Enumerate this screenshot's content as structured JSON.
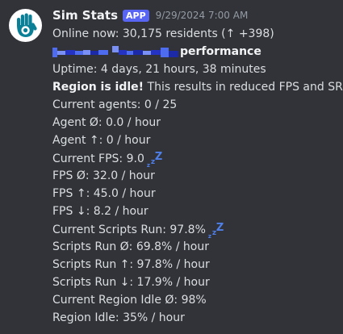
{
  "message": {
    "username": "Sim Stats",
    "badge": "APP",
    "timestamp": "9/29/2024 7:00 AM",
    "avatar_icon": "hand-eye-icon",
    "lines": [
      "Online now: 30,175 residents (↑ +398)",
      "performance",
      "Uptime: 4 days, 21 hours, 38 minutes",
      {
        "bold": "Region is idle!",
        "text": " This results in reduced FPS and SR%!"
      },
      "Current agents: 0 / 25",
      "Agent Ø: 0.0 / hour",
      "Agent ↑: 0 / hour",
      "Current FPS: 9.0",
      "FPS Ø: 32.0 / hour",
      "FPS ↑: 45.0 / hour",
      "FPS ↓: 8.2 / hour",
      "Current Scripts Run: 97.8%",
      "Scripts Run Ø: 69.8% / hour",
      "Scripts Run ↑: 97.8% / hour",
      "Scripts Run ↓: 17.9% / hour",
      "Current Region Idle Ø: 98%",
      "Region Idle: 35% / hour"
    ],
    "sleep_emoji": "zzz-icon",
    "redaction_colors": [
      "#4e6cf0",
      "#2433c4",
      "#7b90f5",
      "#1c2aa8"
    ]
  }
}
